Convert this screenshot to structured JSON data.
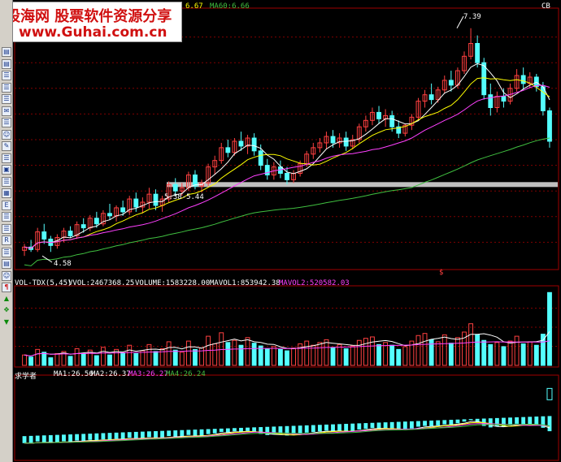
{
  "watermark": {
    "line1": "股海网 股票软件资源分享",
    "line2": "www.Guhai.com.cn"
  },
  "main_panel": {
    "ma_readout_a": "6.67",
    "ma_readout_b": "MA60:6.66",
    "annotation_high": "7.39",
    "annotation_low": "4.58",
    "annotation_band": "5.38-5.44",
    "corner_tag": "CB",
    "marker": "$"
  },
  "volume_panel": {
    "title": "VOL-TDX(5,45)",
    "vvol": "VVOL:2467368.25",
    "volume": "VOLUME:1583228.00",
    "mavol1": "MAVOL1:853942.38",
    "mavol2": "MAVOL2:520582.03"
  },
  "indicator_panel": {
    "title": "求学者",
    "ma1": "MA1:26.56",
    "ma2": "MA2:26.37",
    "ma3": "MA3:26.27",
    "ma4": "MA4:26.24"
  },
  "toolbar": {
    "icons": [
      "chart-icon",
      "chart-icon",
      "list-icon",
      "list-icon",
      "list-icon",
      "mail-icon",
      "list-icon",
      "person-icon",
      "tool-icon",
      "list-icon",
      "window-icon",
      "list-icon",
      "grid-icon",
      "ex-icon",
      "list-icon",
      "list-icon",
      "rs-icon",
      "list-icon",
      "chart-icon",
      "person-icon",
      "signal-icon",
      "arrow-up-green-icon",
      "move-icon",
      "arrow-down-green-icon"
    ]
  },
  "colors": {
    "up": "#ff4040",
    "down": "#54ffff",
    "ma_white": "#ffffff",
    "ma_yellow": "#ffff00",
    "ma_magenta": "#ff40ff",
    "ma_green": "#40c040",
    "band": "#c0c0c0",
    "grid": "#800000"
  },
  "chart_data": {
    "type": "candlestick",
    "price_ylim": [
      4.4,
      7.6
    ],
    "candles": [
      [
        4.62,
        4.7,
        4.55,
        4.66
      ],
      [
        4.66,
        4.75,
        4.6,
        4.63
      ],
      [
        4.63,
        4.9,
        4.6,
        4.85
      ],
      [
        4.85,
        4.95,
        4.7,
        4.76
      ],
      [
        4.76,
        4.8,
        4.6,
        4.68
      ],
      [
        4.68,
        4.82,
        4.64,
        4.78
      ],
      [
        4.78,
        4.9,
        4.72,
        4.86
      ],
      [
        4.86,
        4.92,
        4.78,
        4.8
      ],
      [
        4.8,
        4.98,
        4.76,
        4.94
      ],
      [
        4.94,
        5.02,
        4.84,
        4.9
      ],
      [
        4.9,
        5.06,
        4.86,
        5.02
      ],
      [
        5.02,
        5.1,
        4.9,
        4.95
      ],
      [
        4.95,
        5.12,
        4.92,
        5.08
      ],
      [
        5.08,
        5.2,
        5.0,
        5.05
      ],
      [
        5.05,
        5.18,
        4.98,
        5.15
      ],
      [
        5.15,
        5.24,
        5.05,
        5.1
      ],
      [
        5.1,
        5.3,
        5.06,
        5.26
      ],
      [
        5.26,
        5.34,
        5.1,
        5.16
      ],
      [
        5.16,
        5.28,
        5.08,
        5.22
      ],
      [
        5.22,
        5.4,
        5.14,
        5.32
      ],
      [
        5.32,
        5.38,
        5.12,
        5.18
      ],
      [
        5.18,
        5.3,
        5.1,
        5.26
      ],
      [
        5.26,
        5.48,
        5.22,
        5.44
      ],
      [
        5.44,
        5.52,
        5.3,
        5.36
      ],
      [
        5.36,
        5.46,
        5.3,
        5.4
      ],
      [
        5.4,
        5.6,
        5.36,
        5.56
      ],
      [
        5.56,
        5.62,
        5.38,
        5.42
      ],
      [
        5.42,
        5.5,
        5.34,
        5.46
      ],
      [
        5.46,
        5.7,
        5.42,
        5.66
      ],
      [
        5.66,
        5.8,
        5.56,
        5.74
      ],
      [
        5.74,
        5.96,
        5.7,
        5.9
      ],
      [
        5.9,
        6.0,
        5.78,
        5.84
      ],
      [
        5.84,
        6.02,
        5.8,
        5.98
      ],
      [
        5.98,
        6.1,
        5.86,
        5.92
      ],
      [
        5.92,
        6.06,
        5.82,
        6.02
      ],
      [
        6.02,
        6.08,
        5.8,
        5.86
      ],
      [
        5.86,
        5.94,
        5.62,
        5.68
      ],
      [
        5.68,
        5.76,
        5.5,
        5.56
      ],
      [
        5.56,
        5.72,
        5.5,
        5.66
      ],
      [
        5.66,
        5.74,
        5.52,
        5.58
      ],
      [
        5.58,
        5.66,
        5.44,
        5.5
      ],
      [
        5.5,
        5.62,
        5.46,
        5.58
      ],
      [
        5.58,
        5.74,
        5.54,
        5.7
      ],
      [
        5.7,
        5.86,
        5.66,
        5.82
      ],
      [
        5.82,
        5.96,
        5.76,
        5.9
      ],
      [
        5.9,
        6.02,
        5.84,
        5.96
      ],
      [
        5.96,
        6.1,
        5.88,
        6.04
      ],
      [
        6.04,
        6.12,
        5.9,
        5.96
      ],
      [
        5.96,
        6.08,
        5.9,
        6.02
      ],
      [
        6.02,
        6.1,
        5.86,
        5.92
      ],
      [
        5.92,
        6.06,
        5.88,
        6.0
      ],
      [
        6.0,
        6.2,
        5.96,
        6.16
      ],
      [
        6.16,
        6.3,
        6.1,
        6.24
      ],
      [
        6.24,
        6.4,
        6.18,
        6.34
      ],
      [
        6.34,
        6.42,
        6.2,
        6.26
      ],
      [
        6.26,
        6.38,
        6.16,
        6.3
      ],
      [
        6.3,
        6.36,
        6.1,
        6.16
      ],
      [
        6.16,
        6.24,
        6.02,
        6.08
      ],
      [
        6.08,
        6.2,
        6.04,
        6.18
      ],
      [
        6.18,
        6.32,
        6.12,
        6.28
      ],
      [
        6.28,
        6.52,
        6.24,
        6.48
      ],
      [
        6.48,
        6.62,
        6.4,
        6.56
      ],
      [
        6.56,
        6.7,
        6.44,
        6.5
      ],
      [
        6.5,
        6.66,
        6.46,
        6.62
      ],
      [
        6.62,
        6.8,
        6.58,
        6.74
      ],
      [
        6.74,
        6.86,
        6.6,
        6.68
      ],
      [
        6.68,
        6.9,
        6.64,
        6.86
      ],
      [
        6.86,
        7.1,
        6.82,
        7.04
      ],
      [
        7.04,
        7.39,
        7.0,
        7.2
      ],
      [
        7.2,
        7.3,
        6.9,
        6.96
      ],
      [
        6.96,
        7.02,
        6.5,
        6.56
      ],
      [
        6.56,
        6.7,
        6.3,
        6.4
      ],
      [
        6.4,
        6.6,
        6.34,
        6.54
      ],
      [
        6.54,
        6.64,
        6.4,
        6.48
      ],
      [
        6.48,
        6.7,
        6.44,
        6.64
      ],
      [
        6.64,
        6.88,
        6.6,
        6.8
      ],
      [
        6.8,
        6.9,
        6.62,
        6.7
      ],
      [
        6.7,
        6.84,
        6.64,
        6.78
      ],
      [
        6.78,
        6.82,
        6.6,
        6.66
      ],
      [
        6.66,
        6.72,
        6.3,
        6.36
      ],
      [
        6.36,
        6.4,
        5.9,
        5.98
      ]
    ],
    "volume_values": [
      30,
      24,
      46,
      38,
      22,
      34,
      40,
      26,
      48,
      32,
      44,
      28,
      52,
      30,
      46,
      36,
      58,
      34,
      42,
      60,
      40,
      48,
      68,
      44,
      38,
      70,
      46,
      50,
      84,
      62,
      94,
      66,
      72,
      58,
      80,
      64,
      56,
      48,
      54,
      46,
      42,
      50,
      62,
      70,
      58,
      66,
      74,
      52,
      60,
      48,
      56,
      72,
      78,
      82,
      60,
      66,
      58,
      46,
      54,
      70,
      86,
      92,
      74,
      68,
      88,
      64,
      80,
      96,
      120,
      88,
      72,
      60,
      66,
      54,
      70,
      84,
      62,
      68,
      58,
      90,
      210
    ],
    "indicator_ylim": [
      25.6,
      27.2
    ]
  }
}
